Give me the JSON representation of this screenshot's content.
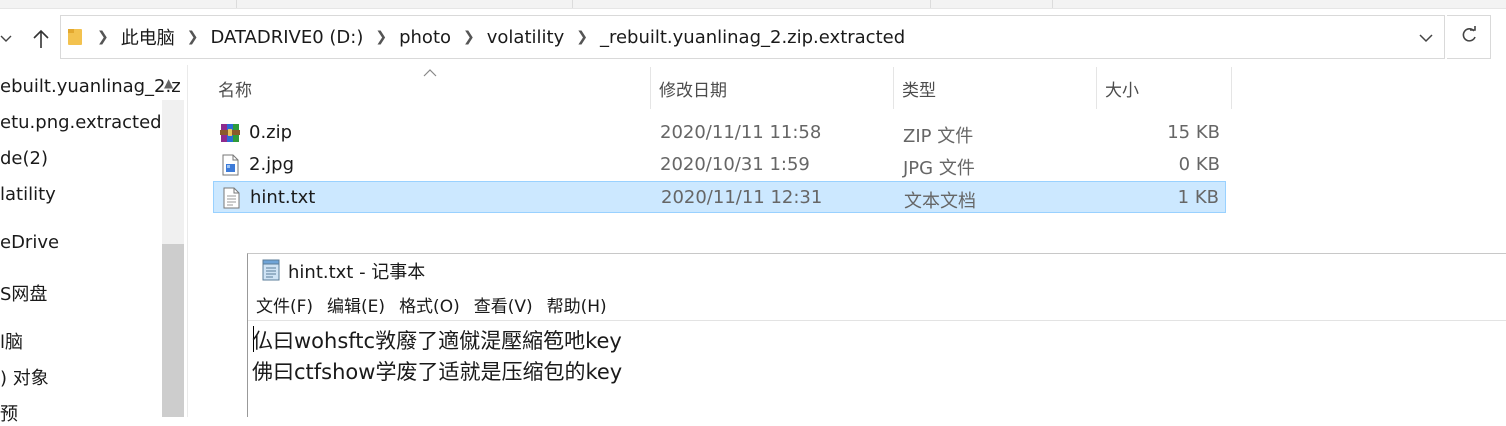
{
  "window": {
    "colors": {
      "selection_bg": "#cce8ff",
      "selection_border": "#99d1ff",
      "header_text": "#4c4c4c"
    }
  },
  "address_bar": {
    "folder_icon": "folder-icon",
    "path": [
      "此电脑",
      "DATADRIVE0 (D:)",
      "photo",
      "volatility",
      "_rebuilt.yuanlinag_2.zip.extracted"
    ],
    "separator": ">"
  },
  "nav_pane": {
    "items": [
      {
        "label": "ebuilt.yuanlinag_2.z"
      },
      {
        "label": "etu.png.extracted"
      },
      {
        "label": "de(2)"
      },
      {
        "label": "latility"
      },
      {
        "label": "eDrive"
      },
      {
        "label": "S网盘"
      },
      {
        "label": "l脑"
      },
      {
        "label": ") 对象"
      },
      {
        "label": "预"
      }
    ]
  },
  "columns": {
    "name": "名称",
    "modified": "修改日期",
    "type": "类型",
    "size": "大小"
  },
  "files": [
    {
      "name": "0.zip",
      "modified": "2020/11/11 11:58",
      "type": "ZIP 文件",
      "size": "15 KB",
      "icon": "winrar-archive-icon"
    },
    {
      "name": "2.jpg",
      "modified": "2020/10/31 1:59",
      "type": "JPG 文件",
      "size": "0 KB",
      "icon": "image-file-icon"
    },
    {
      "name": "hint.txt",
      "modified": "2020/11/11 12:31",
      "type": "文本文档",
      "size": "1 KB",
      "icon": "text-file-icon",
      "selected": true
    }
  ],
  "notepad": {
    "title": "hint.txt - 记事本",
    "menu": [
      "文件(F)",
      "编辑(E)",
      "格式(O)",
      "查看(V)",
      "帮助(H)"
    ],
    "lines": [
      "仏曰wohsftc敩廢了適僦湜壓縮笣吔key",
      "佛曰ctfshow学废了适就是压缩包的key"
    ]
  }
}
